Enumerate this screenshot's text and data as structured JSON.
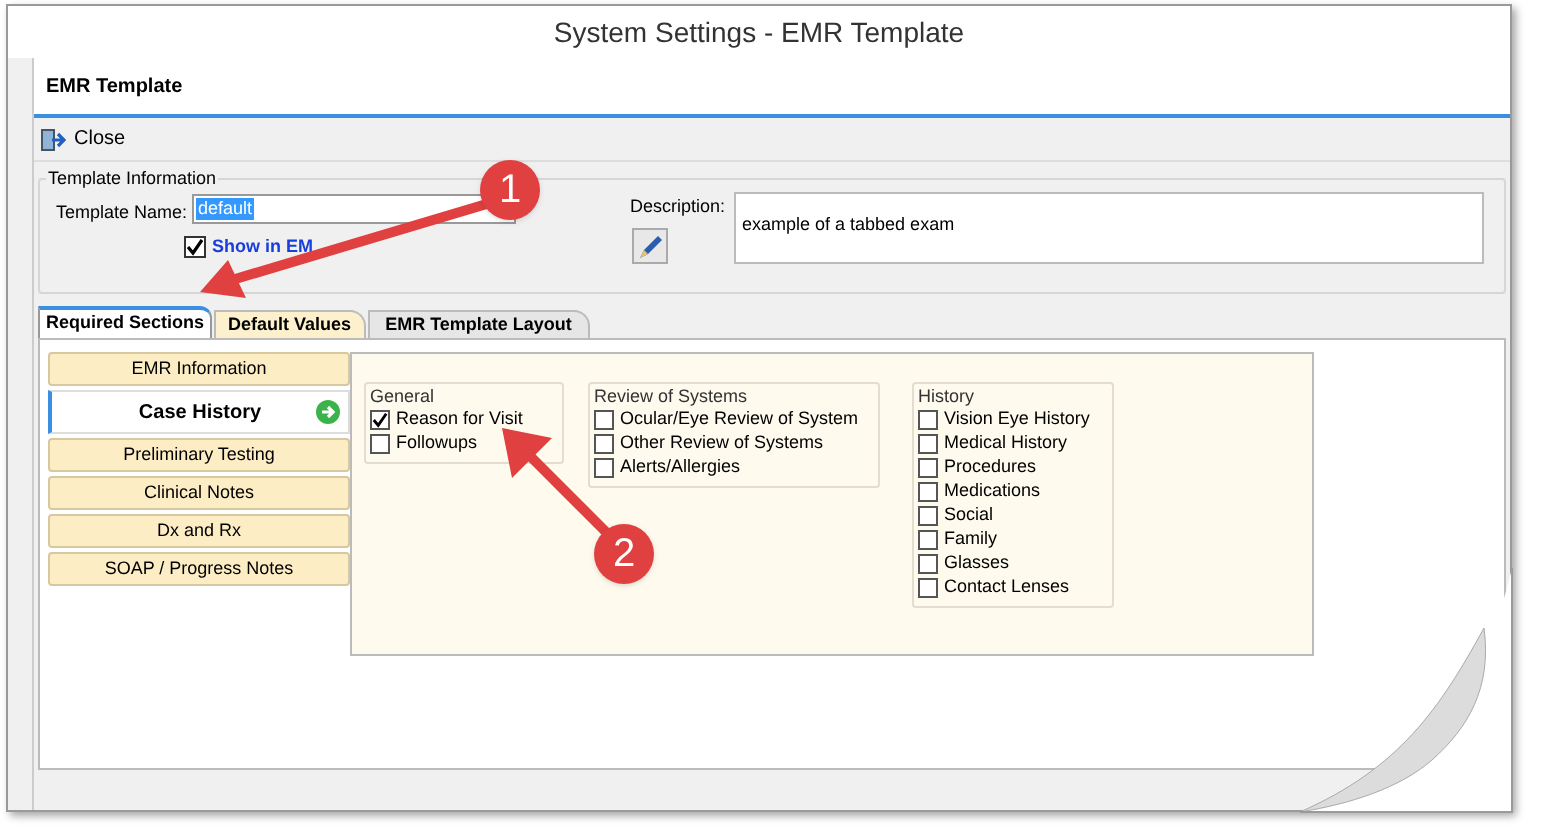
{
  "window": {
    "title": "System Settings - EMR Template"
  },
  "header": {
    "title": "EMR Template"
  },
  "toolbar": {
    "close_label": "Close"
  },
  "template_information": {
    "legend": "Template Information",
    "name_label": "Template Name:",
    "name_value": "default",
    "name_selected": true,
    "show_in_label": "Show in EM",
    "show_in_checked": true,
    "description_label": "Description:",
    "description_value": "example of a tabbed exam"
  },
  "tabs": [
    {
      "label": "Required Sections",
      "selected": true
    },
    {
      "label": "Default Values",
      "selected": false
    },
    {
      "label": "EMR Template Layout",
      "selected": false
    }
  ],
  "sections": [
    {
      "label": "EMR Information",
      "selected": false
    },
    {
      "label": "Case History",
      "selected": true
    },
    {
      "label": "Preliminary Testing",
      "selected": false
    },
    {
      "label": "Clinical Notes",
      "selected": false
    },
    {
      "label": "Dx and Rx",
      "selected": false
    },
    {
      "label": "SOAP / Progress Notes",
      "selected": false
    }
  ],
  "groups": [
    {
      "title": "General",
      "items": [
        {
          "label": "Reason for Visit",
          "checked": true
        },
        {
          "label": "Followups",
          "checked": false
        }
      ]
    },
    {
      "title": "Review of Systems",
      "items": [
        {
          "label": "Ocular/Eye Review of System",
          "checked": false
        },
        {
          "label": "Other Review of Systems",
          "checked": false
        },
        {
          "label": "Alerts/Allergies",
          "checked": false
        }
      ]
    },
    {
      "title": "History",
      "items": [
        {
          "label": "Vision Eye History",
          "checked": false
        },
        {
          "label": "Medical History",
          "checked": false
        },
        {
          "label": "Procedures",
          "checked": false
        },
        {
          "label": "Medications",
          "checked": false
        },
        {
          "label": "Social",
          "checked": false
        },
        {
          "label": "Family",
          "checked": false
        },
        {
          "label": "Glasses",
          "checked": false
        },
        {
          "label": "Contact Lenses",
          "checked": false
        }
      ]
    }
  ],
  "callouts": [
    {
      "number": "1"
    },
    {
      "number": "2"
    }
  ]
}
